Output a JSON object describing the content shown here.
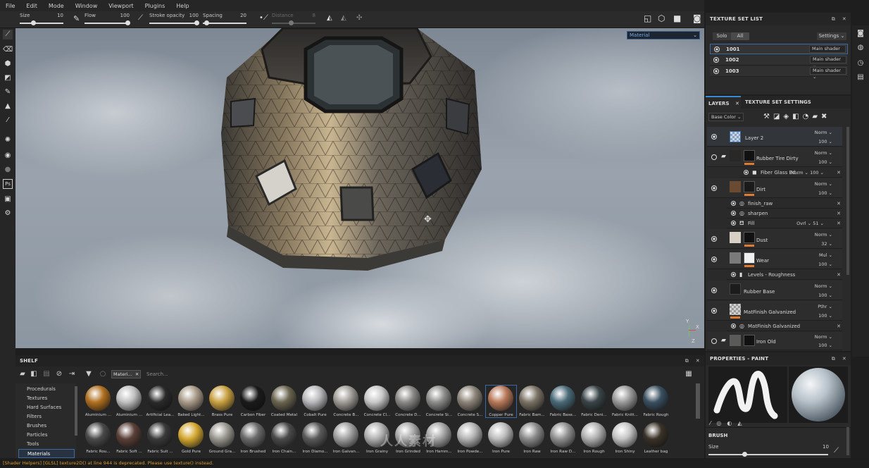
{
  "menu": [
    "File",
    "Edit",
    "Mode",
    "Window",
    "Viewport",
    "Plugins",
    "Help"
  ],
  "tool_options": {
    "size": {
      "label": "Size",
      "value": "10"
    },
    "flow": {
      "label": "Flow",
      "value": "100"
    },
    "stroke_opacity": {
      "label": "Stroke opacity",
      "value": "100"
    },
    "spacing": {
      "label": "Spacing",
      "value": "20"
    },
    "distance": {
      "label": "Distance",
      "value": "8"
    }
  },
  "viewport": {
    "mode_select": "Material",
    "gizmo_axes": {
      "y": "Y",
      "x": "X",
      "z": "Z"
    }
  },
  "texture_set_list": {
    "title": "TEXTURE SET LIST",
    "solo": "Solo",
    "all": "All",
    "settings": "Settings",
    "sets": [
      {
        "name": "1001",
        "shader": "Main shader"
      },
      {
        "name": "1002",
        "shader": "Main shader"
      },
      {
        "name": "1003",
        "shader": "Main shader"
      }
    ]
  },
  "layers_panel": {
    "tab_layers": "LAYERS",
    "tab_settings": "TEXTURE SET SETTINGS",
    "channel": "Base Color",
    "layers": [
      {
        "name": "Layer 2",
        "blend": "Norm",
        "opacity": "100"
      },
      {
        "name": "Rubber Tire Dirty",
        "blend": "Norm",
        "opacity": "100"
      },
      {
        "name": "Fiber Glass Ed...",
        "blend": "Norm",
        "opacity": "100"
      },
      {
        "name": "Dirt",
        "blend": "Norm",
        "opacity": "100"
      },
      {
        "name": "finish_raw"
      },
      {
        "name": "sharpen"
      },
      {
        "name": "Fill",
        "blend": "Ovrl",
        "opacity": "51"
      },
      {
        "name": "Dust",
        "blend": "Norm",
        "opacity": "32"
      },
      {
        "name": "Wear",
        "blend": "Mul",
        "opacity": "100"
      },
      {
        "name": "Levels - Roughness"
      },
      {
        "name": "Rubber Base",
        "blend": "Norm",
        "opacity": "100"
      },
      {
        "name": "MatFinish Galvanized",
        "blend": "Pthr",
        "opacity": "100"
      },
      {
        "name": "MatFinish Galvanized"
      },
      {
        "name": "Iron Old",
        "blend": "Norm",
        "opacity": "100"
      }
    ]
  },
  "properties": {
    "title": "PROPERTIES - PAINT",
    "brush_label": "BRUSH",
    "size_label": "Size",
    "size_value": "10"
  },
  "shelf": {
    "title": "SHELF",
    "filter_chip": "Materi...",
    "search_placeholder": "Search...",
    "categories": [
      "Procedurals",
      "Textures",
      "Hard Surfaces",
      "Filters",
      "Brushes",
      "Particles",
      "Tools",
      "Materials"
    ],
    "materials_row1": [
      "Aluminium ...",
      "Aluminium ...",
      "Artificial Lea...",
      "Baked Light...",
      "Brass Pure",
      "Carbon Fiber",
      "Coated Metal",
      "Cobalt Pure",
      "Concrete B...",
      "Concrete Cl...",
      "Concrete D...",
      "Concrete Si...",
      "Concrete S...",
      "Copper Pure",
      "Fabric Bam...",
      "Fabric Base...",
      "Fabric Deni...",
      "Fabric Knitt...",
      "Fabric Rough"
    ],
    "materials_row2": [
      "Fabric Rou...",
      "Fabric Soft ...",
      "Fabric Suit ...",
      "Gold Pure",
      "Ground Gra...",
      "Iron Brushed",
      "Iron Chain...",
      "Iron Diamo...",
      "Iron Galvan...",
      "Iron Grainy",
      "Iron Grinded",
      "Iron Hamm...",
      "Iron Powde...",
      "Iron Pure",
      "Iron Raw",
      "Iron Raw D...",
      "Iron Rough",
      "Iron Shiny",
      "Leather bag"
    ],
    "colors_row1": [
      "#b07020",
      "#c0c0c0",
      "#2a2a2a",
      "#a89a88",
      "#c8a040",
      "#1a1a1a",
      "#6a6450",
      "#b8b8bc",
      "#a09c96",
      "#c8c8c8",
      "#8a8886",
      "#8c8c8a",
      "#8c8478",
      "#b87858",
      "#7a7264",
      "#4a6a78",
      "#3a4448",
      "#9a9a9a",
      "#3a5060"
    ],
    "colors_row2": [
      "#4a4a4a",
      "#5a4038",
      "#3a3a3a",
      "#d4a830",
      "#9a9890",
      "#6a6a6a",
      "#4a4a4a",
      "#5a5a5a",
      "#a0a0a0",
      "#b0b0b0",
      "#a8a8a8",
      "#a4a4a4",
      "#b4b4b4",
      "#bcbcbc",
      "#8a8a8a",
      "#909090",
      "#b0b0b0",
      "#c4c4c4",
      "#3a3228"
    ]
  },
  "status_message": "[Shader Helpers] [GLSL] texture2D() at line 944 is deprecated. Please use texture() instead.",
  "watermark": "人人素材"
}
